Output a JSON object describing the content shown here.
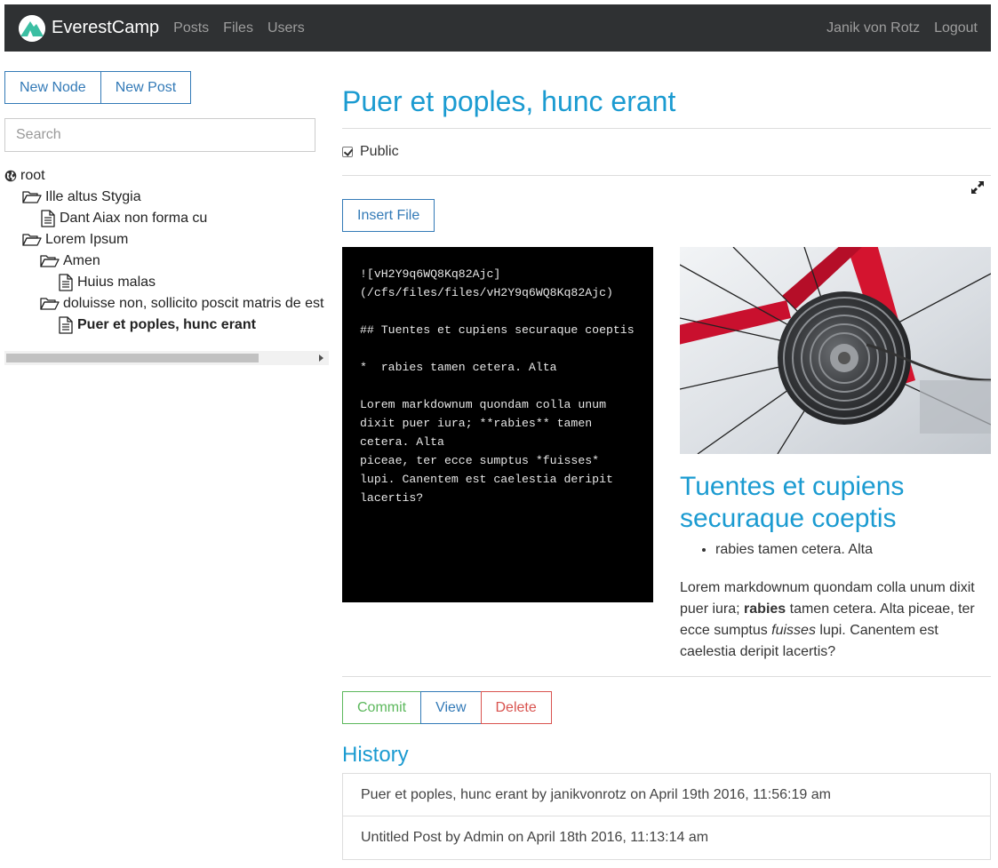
{
  "navbar": {
    "brand": "EverestCamp",
    "links": [
      "Posts",
      "Files",
      "Users"
    ],
    "user": "Janik von Rotz",
    "logout": "Logout"
  },
  "sidebar": {
    "new_node": "New Node",
    "new_post": "New Post",
    "search_placeholder": "Search",
    "tree": [
      {
        "label": "root",
        "icon": "globe-icon",
        "depth": 0
      },
      {
        "label": "Ille altus Stygia",
        "icon": "folder-open-icon",
        "depth": 1
      },
      {
        "label": "Dant Aiax non forma cu",
        "icon": "file-icon",
        "depth": 2
      },
      {
        "label": "Lorem Ipsum",
        "icon": "folder-open-icon",
        "depth": 1
      },
      {
        "label": "Amen",
        "icon": "folder-open-icon",
        "depth": 2
      },
      {
        "label": "Huius malas",
        "icon": "file-icon",
        "depth": 3
      },
      {
        "label": "doluisse non, sollicito poscit matris de est",
        "icon": "folder-open-icon",
        "depth": 2
      },
      {
        "label": "Puer et poples, hunc erant",
        "icon": "file-icon",
        "depth": 3,
        "active": true
      }
    ]
  },
  "post": {
    "title": "Puer et poples, hunc erant",
    "public_label": "Public",
    "public_checked": true,
    "insert_file": "Insert File",
    "editor_text": "![vH2Y9q6WQ8Kq82Ajc]\n(/cfs/files/files/vH2Y9q6WQ8Kq82Ajc)\n\n## Tuentes et cupiens securaque coeptis\n\n*  rabies tamen cetera. Alta\n\nLorem markdownum quondam colla unum dixit puer iura; **rabies** tamen cetera. Alta\npiceae, ter ecce sumptus *fuisses* lupi. Canentem est caelestia deripit lacertis?",
    "preview": {
      "heading": "Tuentes et cupiens securaque coeptis",
      "bullet": "rabies tamen cetera. Alta",
      "para_1": "Lorem markdownum quondam colla unum dixit puer iura; ",
      "para_bold": "rabies",
      "para_2": " tamen cetera. Alta piceae, ter ecce sumptus ",
      "para_italic": "fuisses",
      "para_3": " lupi. Canentem est caelestia deripit lacertis?"
    },
    "actions": {
      "commit": "Commit",
      "view": "View",
      "delete": "Delete"
    }
  },
  "history": {
    "title": "History",
    "items": [
      "Puer et poples, hunc erant by janikvonrotz on April 19th 2016, 11:56:19 am",
      "Untitled Post by Admin on April 18th 2016, 11:13:14 am"
    ]
  }
}
